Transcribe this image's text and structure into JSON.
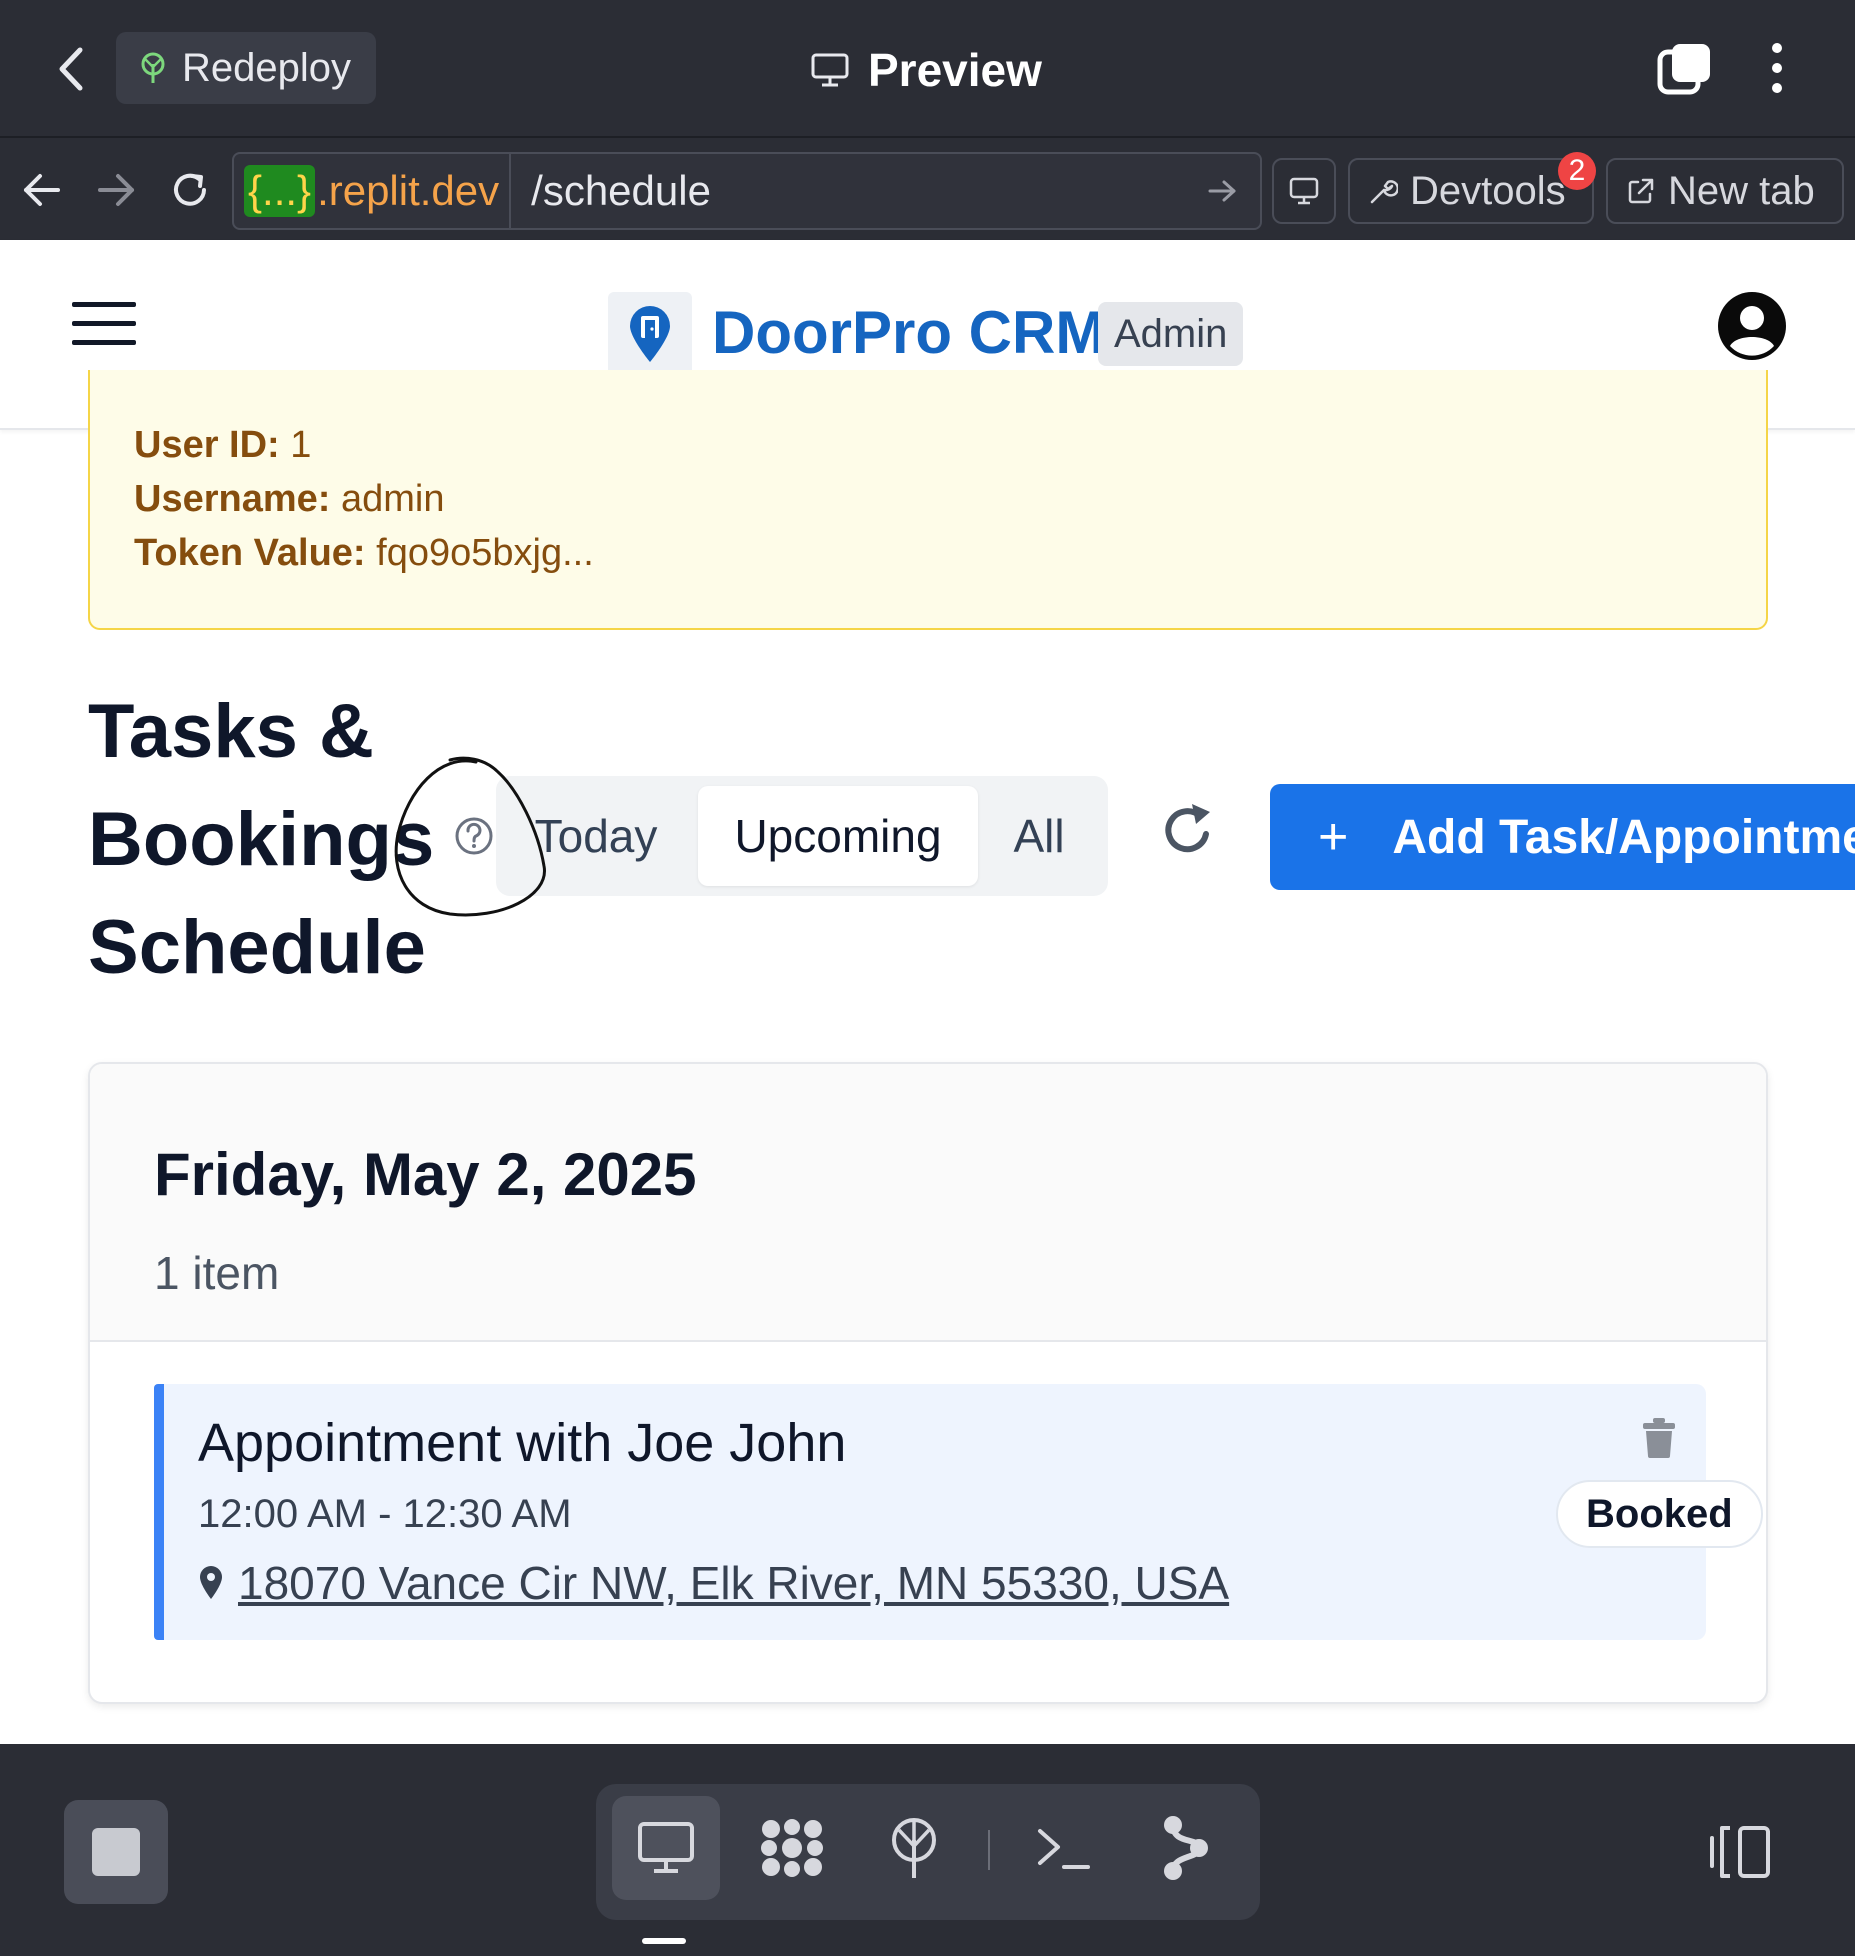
{
  "browser": {
    "redeploy_label": "Redeploy",
    "title": "Preview",
    "url_host_badge": "{...}",
    "url_host": ".replit.dev",
    "url_path": "/schedule",
    "devtools_label": "Devtools",
    "devtools_badge": "2",
    "new_tab_label": "New tab"
  },
  "header": {
    "brand": "DoorPro CRM",
    "role_tag": "Admin"
  },
  "debug": {
    "user_id_label": "User ID:",
    "user_id": "1",
    "username_label": "Username:",
    "username": "admin",
    "token_label": "Token Value:",
    "token": "fqo9o5bxjg..."
  },
  "page": {
    "title_line1": "Tasks &",
    "title_line2": "Bookings",
    "title_line3": "Schedule",
    "filters": [
      "Today",
      "Upcoming",
      "All"
    ],
    "active_filter": "Upcoming",
    "add_button": "Add Task/Appointmen",
    "add_plus": "+"
  },
  "schedule": {
    "date": "Friday, May 2, 2025",
    "count": "1 item",
    "appointment": {
      "title": "Appointment with Joe John",
      "time": "12:00 AM - 12:30 AM",
      "address": "18070 Vance Cir NW, Elk River, MN 55330, USA",
      "status": "Booked"
    }
  },
  "colors": {
    "brand_blue": "#1565c0",
    "primary_button": "#1a73e8",
    "appointment_accent": "#3b82f6",
    "chrome_bg": "#2b2d35",
    "warning_bg": "#fefce8"
  },
  "icons": [
    "back-chevron-icon",
    "redeploy-icon",
    "monitor-icon",
    "tabs-icon",
    "more-vertical-icon",
    "arrow-left-icon",
    "arrow-right-icon",
    "reload-icon",
    "go-arrow-icon",
    "wrench-icon",
    "external-link-icon",
    "hamburger-icon",
    "map-pin-logo-icon",
    "user-circle-icon",
    "help-circle-icon",
    "refresh-icon",
    "trash-icon",
    "location-pin-icon",
    "stop-icon",
    "puzzle-icon",
    "terminal-icon",
    "git-branch-icon",
    "split-view-icon"
  ]
}
